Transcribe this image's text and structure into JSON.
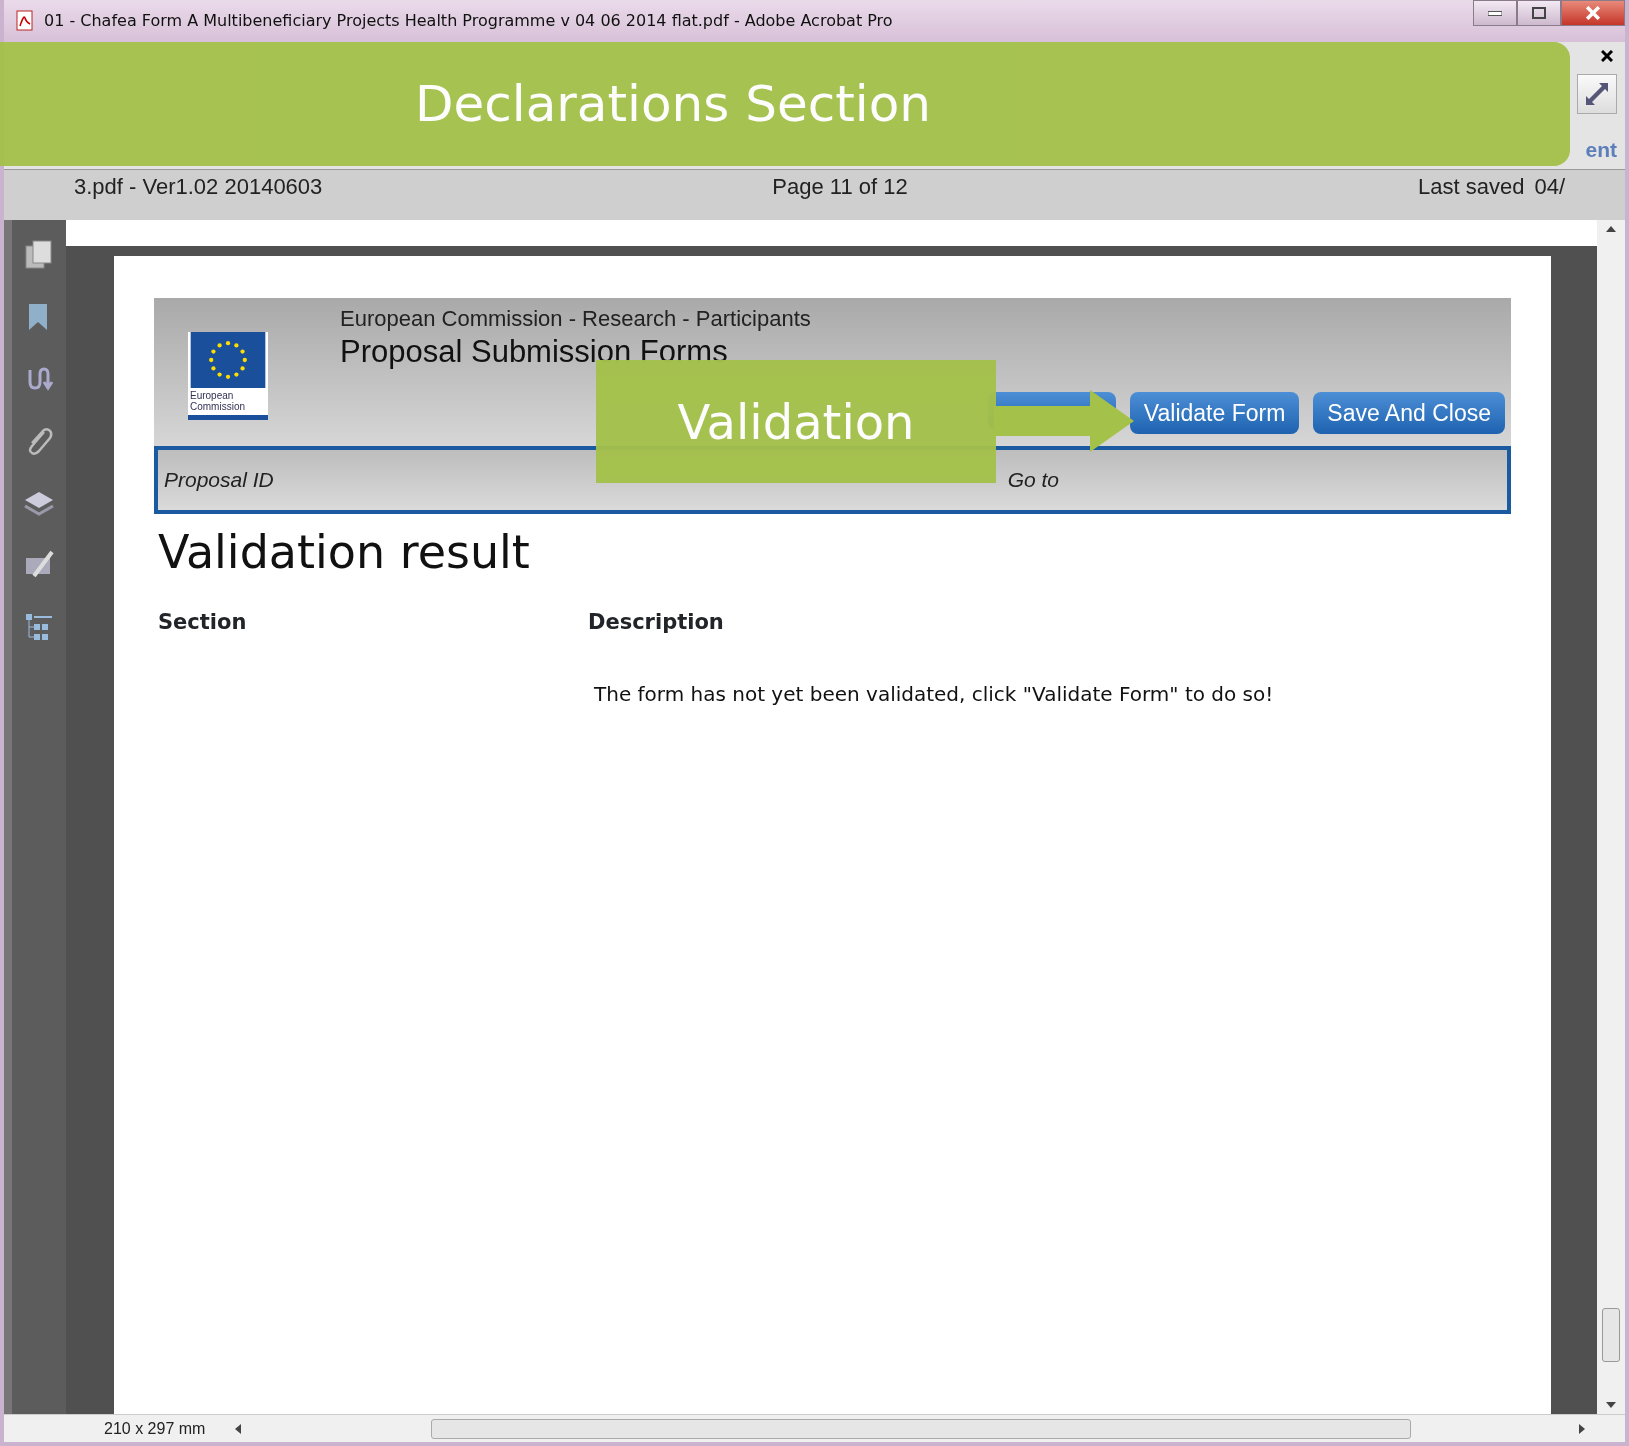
{
  "window": {
    "title": "01 - Chafea Form A Multibeneficiary Projects Health Programme v 04 06 2014 flat.pdf - Adobe Acrobat Pro"
  },
  "toolbar": {
    "tab_label": "ent"
  },
  "doc_bar": {
    "file": "3.pdf - Ver1.02 20140603",
    "page": "Page 11 of 12",
    "saved_label": "Last saved",
    "saved_value": "04/"
  },
  "form": {
    "org": "European Commission - Research - Participants",
    "title": "Proposal Submission Forms",
    "logo_text": "European Commission",
    "buttons": [
      {
        "label": "Validate Form"
      },
      {
        "label": "Save And Close"
      }
    ],
    "fields": [
      "Proposal ID",
      "Go to"
    ],
    "heading": "Validation result",
    "columns": [
      "Section",
      "Description"
    ],
    "message": "The form has not yet been validated, click \"Validate Form\" to do so!"
  },
  "callouts": [
    {
      "kind": "banner",
      "text": "Declarations Section"
    },
    {
      "kind": "arrow",
      "text": "Validation"
    }
  ],
  "status_bar": {
    "page_size": "210 x 297 mm"
  }
}
